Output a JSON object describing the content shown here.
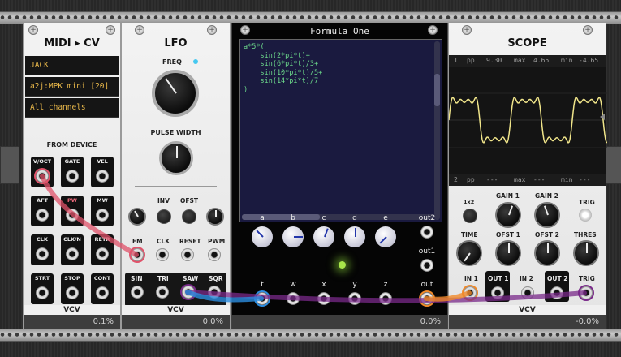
{
  "midi_cv": {
    "title": "MIDI ▸ CV",
    "driver": "JACK",
    "device": "a2j:MPK mini [20]",
    "channel": "All channels",
    "section_label": "FROM DEVICE",
    "ports": [
      "V/OCT",
      "GATE",
      "VEL",
      "AFT",
      "PW",
      "MW",
      "CLK",
      "CLK/N",
      "RETR",
      "STRT",
      "STOP",
      "CONT"
    ],
    "brand": "VCV",
    "cpu": "0.1%"
  },
  "lfo": {
    "title": "LFO",
    "freq_label": "FREQ",
    "pw_label": "PULSE WIDTH",
    "inv_label": "INV",
    "ofst_label": "OFST",
    "input_labels": [
      "FM",
      "CLK",
      "RESET",
      "PWM"
    ],
    "output_labels": [
      "SIN",
      "TRI",
      "SAW",
      "SQR"
    ],
    "brand": "VCV",
    "cpu": "0.0%"
  },
  "formula_one": {
    "title": "Formula One",
    "formula_lines": [
      "a*5*(",
      "    sin(2*pi*t)+",
      "    sin(6*pi*t)/3+",
      "    sin(10*pi*t)/5+",
      "    sin(14*pi*t)/7",
      ")"
    ],
    "param_labels": [
      "a",
      "b",
      "c",
      "d",
      "e"
    ],
    "out2_label": "out2",
    "out1_label": "out1",
    "input_labels": [
      "t",
      "w",
      "x",
      "y",
      "z"
    ],
    "out_label": "out",
    "cpu": "0.0%"
  },
  "scope": {
    "title": "SCOPE",
    "ch1_stats": {
      "ch": "1",
      "pp_label": "pp",
      "pp": "9.30",
      "max_label": "max",
      "max": "4.65",
      "min_label": "min",
      "min": "-4.65"
    },
    "ch2_stats": {
      "ch": "2",
      "pp_label": "pp",
      "pp": "---",
      "max_label": "max",
      "max": "---",
      "min_label": "min",
      "min": "---"
    },
    "knob_labels": [
      "1x2",
      "GAIN 1",
      "GAIN 2",
      "TRIG",
      "TIME",
      "OFST 1",
      "OFST 2",
      "THRES"
    ],
    "port_labels": [
      "IN 1",
      "OUT 1",
      "IN 2",
      "OUT 2",
      "TRIG"
    ],
    "trace_color": "#f0e58a",
    "brand": "VCV",
    "cpu": "-0.0%"
  },
  "cables": {
    "pink": "#e0526a",
    "blue": "#2c8de0",
    "purple": "#7a2a8a",
    "orange": "#f08a2a"
  }
}
